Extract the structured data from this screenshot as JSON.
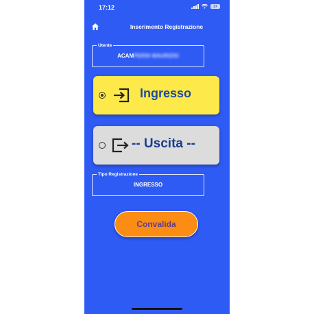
{
  "status_bar": {
    "time": "17:12",
    "battery": "37"
  },
  "header": {
    "title": "Inserimento Registrazione",
    "home_icon": "home-icon"
  },
  "utente": {
    "legend": "Utente",
    "value_visible": "ACAM",
    "value_blurred": "PERSI MAURIZIO"
  },
  "options": {
    "ingresso": {
      "label": "Ingresso",
      "selected": true,
      "icon": "login-icon",
      "color": "#fde94a"
    },
    "uscita": {
      "label": "-- Uscita --",
      "selected": false,
      "icon": "logout-icon",
      "color": "#dcdcdc"
    }
  },
  "tipo_registrazione": {
    "legend": "Tipo Registrazione",
    "value": "INGRESSO"
  },
  "confirm_button": {
    "label": "Convalida",
    "color": "#fb8c14"
  },
  "theme": {
    "background": "#2f5bf5",
    "label_color": "#1f4aa0"
  }
}
